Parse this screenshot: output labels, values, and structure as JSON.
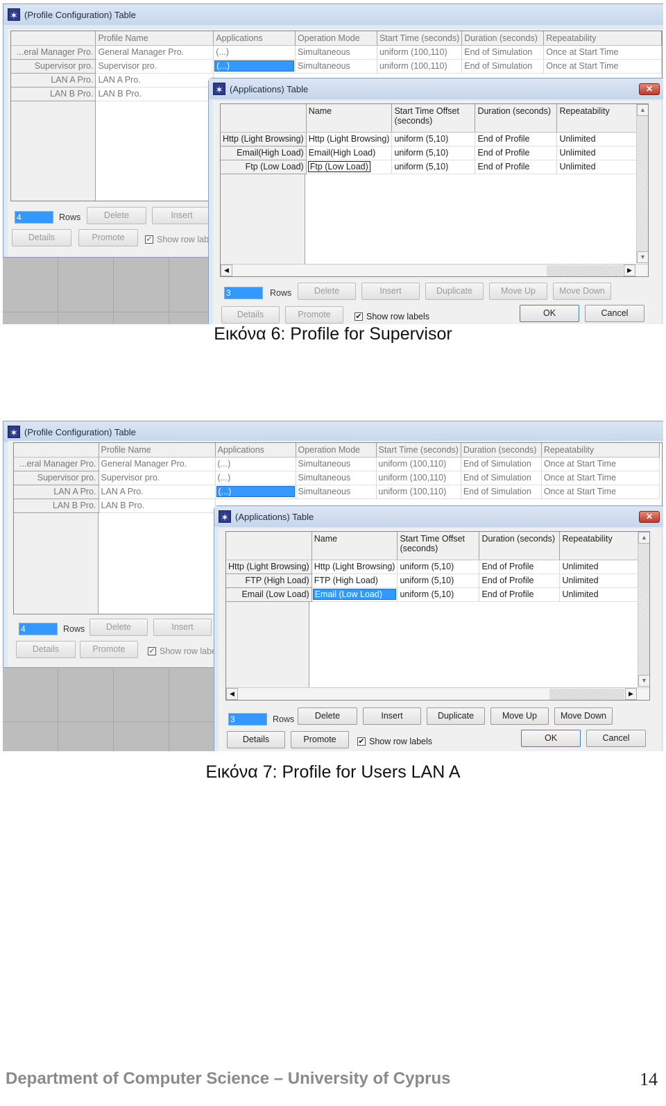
{
  "figures": [
    {
      "caption": "Εικόνα 6: Profile for Supervisor",
      "profile_window": {
        "title": "(Profile Configuration) Table",
        "columns": [
          "Profile Name",
          "Applications",
          "Operation Mode",
          "Start Time (seconds)",
          "Duration (seconds)",
          "Repeatability"
        ],
        "rows": [
          {
            "label": "...eral Manager Pro.",
            "cells": [
              "General Manager Pro.",
              "(...)",
              "Simultaneous",
              "uniform (100,110)",
              "End of Simulation",
              "Once at Start Time"
            ]
          },
          {
            "label": "Supervisor pro.",
            "cells": [
              "Supervisor pro.",
              "(...)",
              "Simultaneous",
              "uniform (100,110)",
              "End of Simulation",
              "Once at Start Time"
            ]
          },
          {
            "label": "LAN A Pro.",
            "cells": [
              "LAN A Pro."
            ]
          },
          {
            "label": "LAN B Pro.",
            "cells": [
              "LAN B Pro."
            ]
          }
        ],
        "selected_row": 1,
        "rows_value": "4",
        "rows_label": "Rows",
        "buttons": {
          "delete": "Delete",
          "insert": "Insert",
          "details": "Details",
          "promote": "Promote"
        },
        "show_row_labels": "Show row lab",
        "show_row_labels_checked": true
      },
      "apps_window": {
        "title": "(Applications) Table",
        "columns": [
          "Name",
          "Start Time Offset (seconds)",
          "Duration (seconds)",
          "Repeatability"
        ],
        "rows": [
          {
            "label": "Http (Light Browsing)",
            "cells": [
              "Http (Light Browsing)",
              "uniform (5,10)",
              "End of Profile",
              "Unlimited"
            ]
          },
          {
            "label": "Email(High Load)",
            "cells": [
              "Email(High Load)",
              "uniform (5,10)",
              "End of Profile",
              "Unlimited"
            ]
          },
          {
            "label": "Ftp (Low Load)",
            "cells": [
              "Ftp (Low Load)",
              "uniform (5,10)",
              "End of Profile",
              "Unlimited"
            ]
          }
        ],
        "rows_value": "3",
        "rows_label": "Rows",
        "buttons_enabled": false,
        "buttons": {
          "delete": "Delete",
          "insert": "Insert",
          "duplicate": "Duplicate",
          "move_up": "Move Up",
          "move_down": "Move Down",
          "details": "Details",
          "promote": "Promote",
          "ok": "OK",
          "cancel": "Cancel"
        },
        "show_row_labels": "Show row labels",
        "show_row_labels_checked": true
      }
    },
    {
      "caption": "Εικόνα 7: Profile for Users LAN A",
      "profile_window": {
        "title": "(Profile Configuration) Table",
        "columns": [
          "Profile Name",
          "Applications",
          "Operation Mode",
          "Start Time (seconds)",
          "Duration (seconds)",
          "Repeatability"
        ],
        "rows": [
          {
            "label": "...eral Manager Pro.",
            "cells": [
              "General Manager Pro.",
              "(...)",
              "Simultaneous",
              "uniform (100,110)",
              "End of Simulation",
              "Once at Start Time"
            ]
          },
          {
            "label": "Supervisor pro.",
            "cells": [
              "Supervisor pro.",
              "(...)",
              "Simultaneous",
              "uniform (100,110)",
              "End of Simulation",
              "Once at Start Time"
            ]
          },
          {
            "label": "LAN A Pro.",
            "cells": [
              "LAN A Pro.",
              "(...)",
              "Simultaneous",
              "uniform (100,110)",
              "End of Simulation",
              "Once at Start Time"
            ]
          },
          {
            "label": "LAN B Pro.",
            "cells": [
              "LAN B Pro."
            ]
          }
        ],
        "selected_row": 2,
        "rows_value": "4",
        "rows_label": "Rows",
        "buttons": {
          "delete": "Delete",
          "insert": "Insert",
          "details": "Details",
          "promote": "Promote"
        },
        "show_row_labels": "Show row label",
        "show_row_labels_checked": true
      },
      "apps_window": {
        "title": "(Applications) Table",
        "columns": [
          "Name",
          "Start Time Offset (seconds)",
          "Duration (seconds)",
          "Repeatability"
        ],
        "rows": [
          {
            "label": "Http (Light Browsing)",
            "cells": [
              "Http (Light Browsing)",
              "uniform (5,10)",
              "End of Profile",
              "Unlimited"
            ]
          },
          {
            "label": "FTP (High Load)",
            "cells": [
              "FTP (High Load)",
              "uniform (5,10)",
              "End of Profile",
              "Unlimited"
            ]
          },
          {
            "label": "Email (Low Load)",
            "cells": [
              "Email (Low Load)",
              "uniform (5,10)",
              "End of Profile",
              "Unlimited"
            ]
          }
        ],
        "rows_value": "3",
        "rows_label": "Rows",
        "buttons_enabled": true,
        "buttons": {
          "delete": "Delete",
          "insert": "Insert",
          "duplicate": "Duplicate",
          "move_up": "Move Up",
          "move_down": "Move Down",
          "details": "Details",
          "promote": "Promote",
          "ok": "OK",
          "cancel": "Cancel"
        },
        "show_row_labels": "Show row labels",
        "show_row_labels_checked": true
      }
    }
  ],
  "footer": {
    "text": "Department of Computer Science – University of Cyprus",
    "page_number": "14"
  }
}
